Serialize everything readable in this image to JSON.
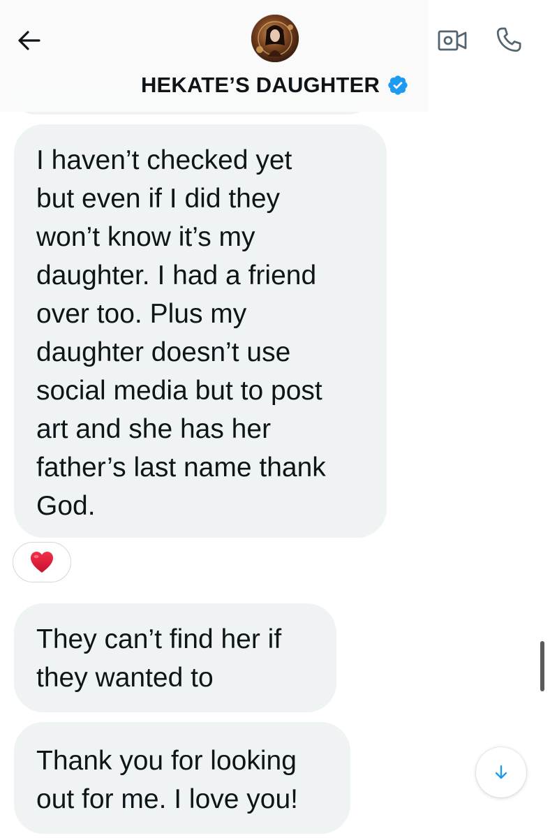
{
  "header": {
    "contact_name": "HEKATE’S DAUGHTER",
    "verified": true,
    "icons": {
      "back": "arrow-left-icon",
      "video": "video-camera-icon",
      "phone": "phone-icon",
      "verified": "verified-badge-icon"
    }
  },
  "messages": [
    {
      "text": "I haven’t checked yet\nbut even if I did they\nwon’t know it’s my\ndaughter. I had a friend\nover too. Plus my\ndaughter doesn’t use\nsocial media but to post\nart and she has her\nfather’s last name thank\nGod.",
      "reaction": "❤️"
    },
    {
      "text": "They can’t find her if\nthey wanted to"
    },
    {
      "text": "Thank you for looking\nout for me. I love you!"
    }
  ],
  "colors": {
    "bubble_bg": "#eff3f4",
    "text": "#0f1419",
    "accent": "#1d9bf0",
    "heart": "#e0245e"
  }
}
